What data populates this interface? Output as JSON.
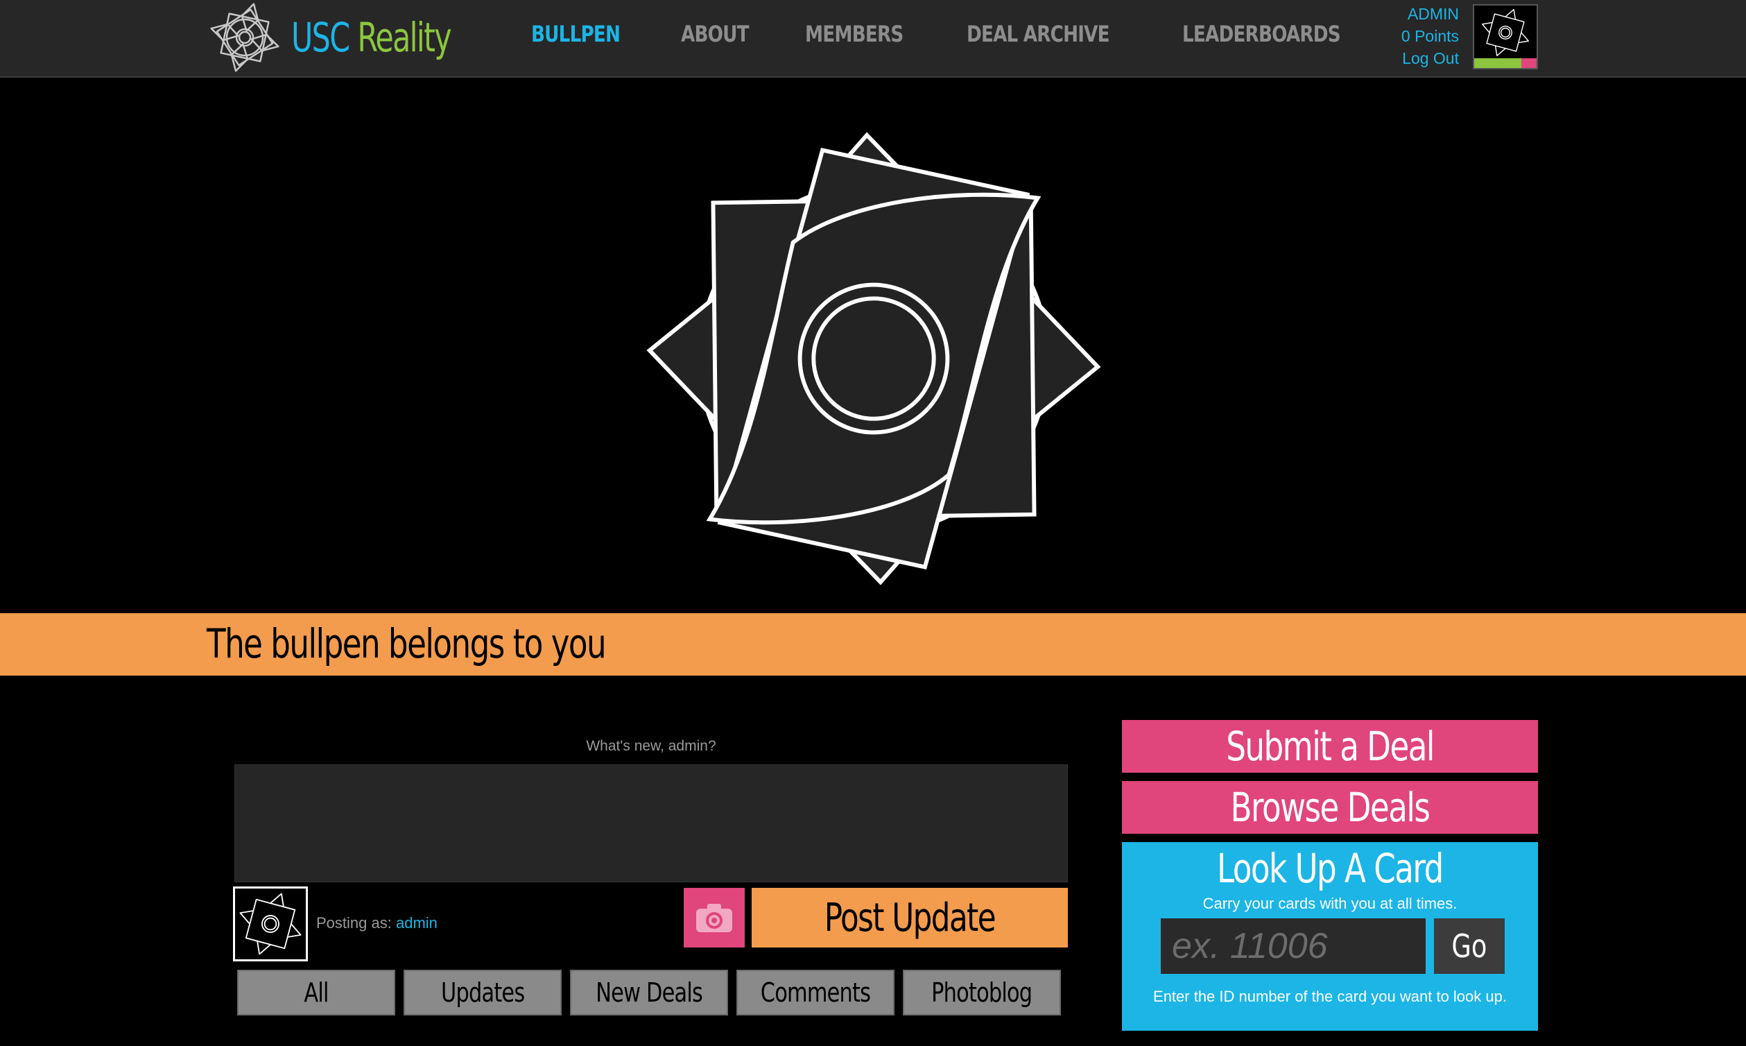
{
  "brand": {
    "usc": "USC",
    "reality": "Reality",
    "colors": {
      "blue": "#1cb5e5",
      "green": "#8cc63f",
      "pink": "#e0457b",
      "orange": "#f39c4e"
    }
  },
  "nav": {
    "items": [
      {
        "label": "BULLPEN",
        "active": true
      },
      {
        "label": "ABOUT",
        "active": false
      },
      {
        "label": "MEMBERS",
        "active": false
      },
      {
        "label": "DEAL ARCHIVE",
        "active": false
      },
      {
        "label": "LEADERBOARDS",
        "active": false
      }
    ]
  },
  "user": {
    "name": "ADMIN",
    "points": "0 Points",
    "logout": "Log Out"
  },
  "banner": {
    "title": "The bullpen belongs to you"
  },
  "composer": {
    "prompt": "What's new, admin?",
    "value": "",
    "posting_as_label": "Posting as:",
    "posting_as_user": "admin",
    "camera_icon": "camera-icon",
    "post_label": "Post Update"
  },
  "filters": [
    "All",
    "Updates",
    "New Deals",
    "Comments",
    "Photoblog"
  ],
  "sidebar": {
    "submit_deal": "Submit a Deal",
    "browse_deals": "Browse Deals",
    "lookup": {
      "title": "Look Up A Card",
      "subtitle": "Carry your cards with you at all times.",
      "placeholder": "ex. 11006",
      "go": "Go",
      "help": "Enter the ID number of the card you want to look up."
    }
  }
}
